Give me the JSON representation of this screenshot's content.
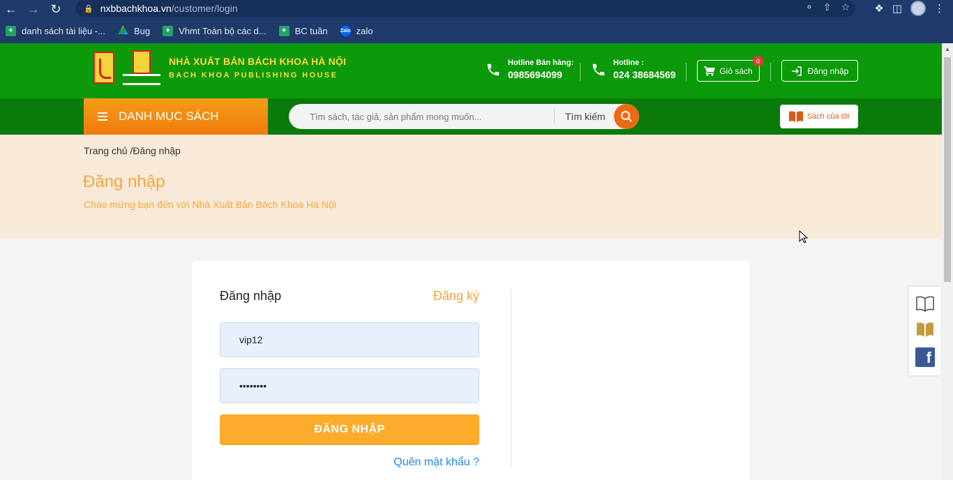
{
  "browser": {
    "url_host": "nxbbachkhoa.vn",
    "url_path": "/customer/login",
    "bookmarks": [
      {
        "label": "danh sách tài liệu -...",
        "icon": "sheets-icon"
      },
      {
        "label": "Bug",
        "icon": "drive-icon"
      },
      {
        "label": "Vhmt Toàn bộ các d...",
        "icon": "sheets-icon"
      },
      {
        "label": "BC tuần",
        "icon": "sheets-icon"
      },
      {
        "label": "zalo",
        "icon": "zalo-icon"
      }
    ]
  },
  "header": {
    "logo_line1": "NHÀ XUẤT BẢN BÁCH KHOA HÀ NỘI",
    "logo_line2": "BACH KHOA PUBLISHING HOUSE",
    "hotline_sales_label": "Hotline Bán hàng:",
    "hotline_sales_number": "0985694099",
    "hotline_label": "Hotline :",
    "hotline_number": "024 38684569",
    "cart_label": "Giỏ sách",
    "cart_count": "0",
    "login_label": "Đăng nhập"
  },
  "nav": {
    "category_label": "DANH MỤC SÁCH",
    "search_placeholder": "Tìm sách, tác giả, sản phẩm mong muốn...",
    "search_button": "Tìm kiếm",
    "my_books": "Sách của tôi"
  },
  "banner": {
    "breadcrumb": "Trang chủ /Đăng nhập",
    "title": "Đăng nhập",
    "subtitle": "Chào mừng bạn đến với Nhà Xuất Bản Bách Khoa Hà Nội"
  },
  "form": {
    "tab_login": "Đăng nhập",
    "tab_register": "Đăng ký",
    "username_value": "vip12",
    "password_value": "••••••••",
    "submit_label": "ĐĂNG NHẬP",
    "forgot_label": "Quên mật khẩu ?"
  },
  "colors": {
    "header_green": "#0c9a0a",
    "nav_green": "#0a7a0b",
    "accent_orange": "#f5a63c",
    "button_orange": "#fcab2b"
  }
}
